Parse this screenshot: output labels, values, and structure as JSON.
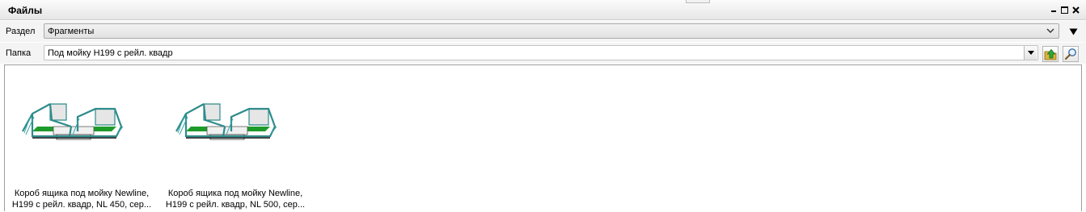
{
  "panel": {
    "title": "Файлы"
  },
  "section": {
    "label": "Раздел",
    "value": "Фрагменты"
  },
  "folder": {
    "label": "Папка",
    "value": "Под мойку H199 с рейл. квадр"
  },
  "files": [
    {
      "line1": "Короб ящика под мойку Newline,",
      "line2": "H199 с рейл. квадр, NL 450, сер..."
    },
    {
      "line1": "Короб ящика под мойку Newline,",
      "line2": "H199 с рейл. квадр, NL 500, сер..."
    }
  ],
  "icons": {
    "minimize": "minimize-icon",
    "maximize": "maximize-icon",
    "close": "close-icon",
    "dropdown": "chevron-down-icon",
    "menu": "triangle-down-icon",
    "folder_up": "folder-up-icon",
    "search": "search-icon"
  },
  "colors": {
    "frame_teal": "#2e8b8b",
    "shelf_green": "#1f9b2c"
  }
}
